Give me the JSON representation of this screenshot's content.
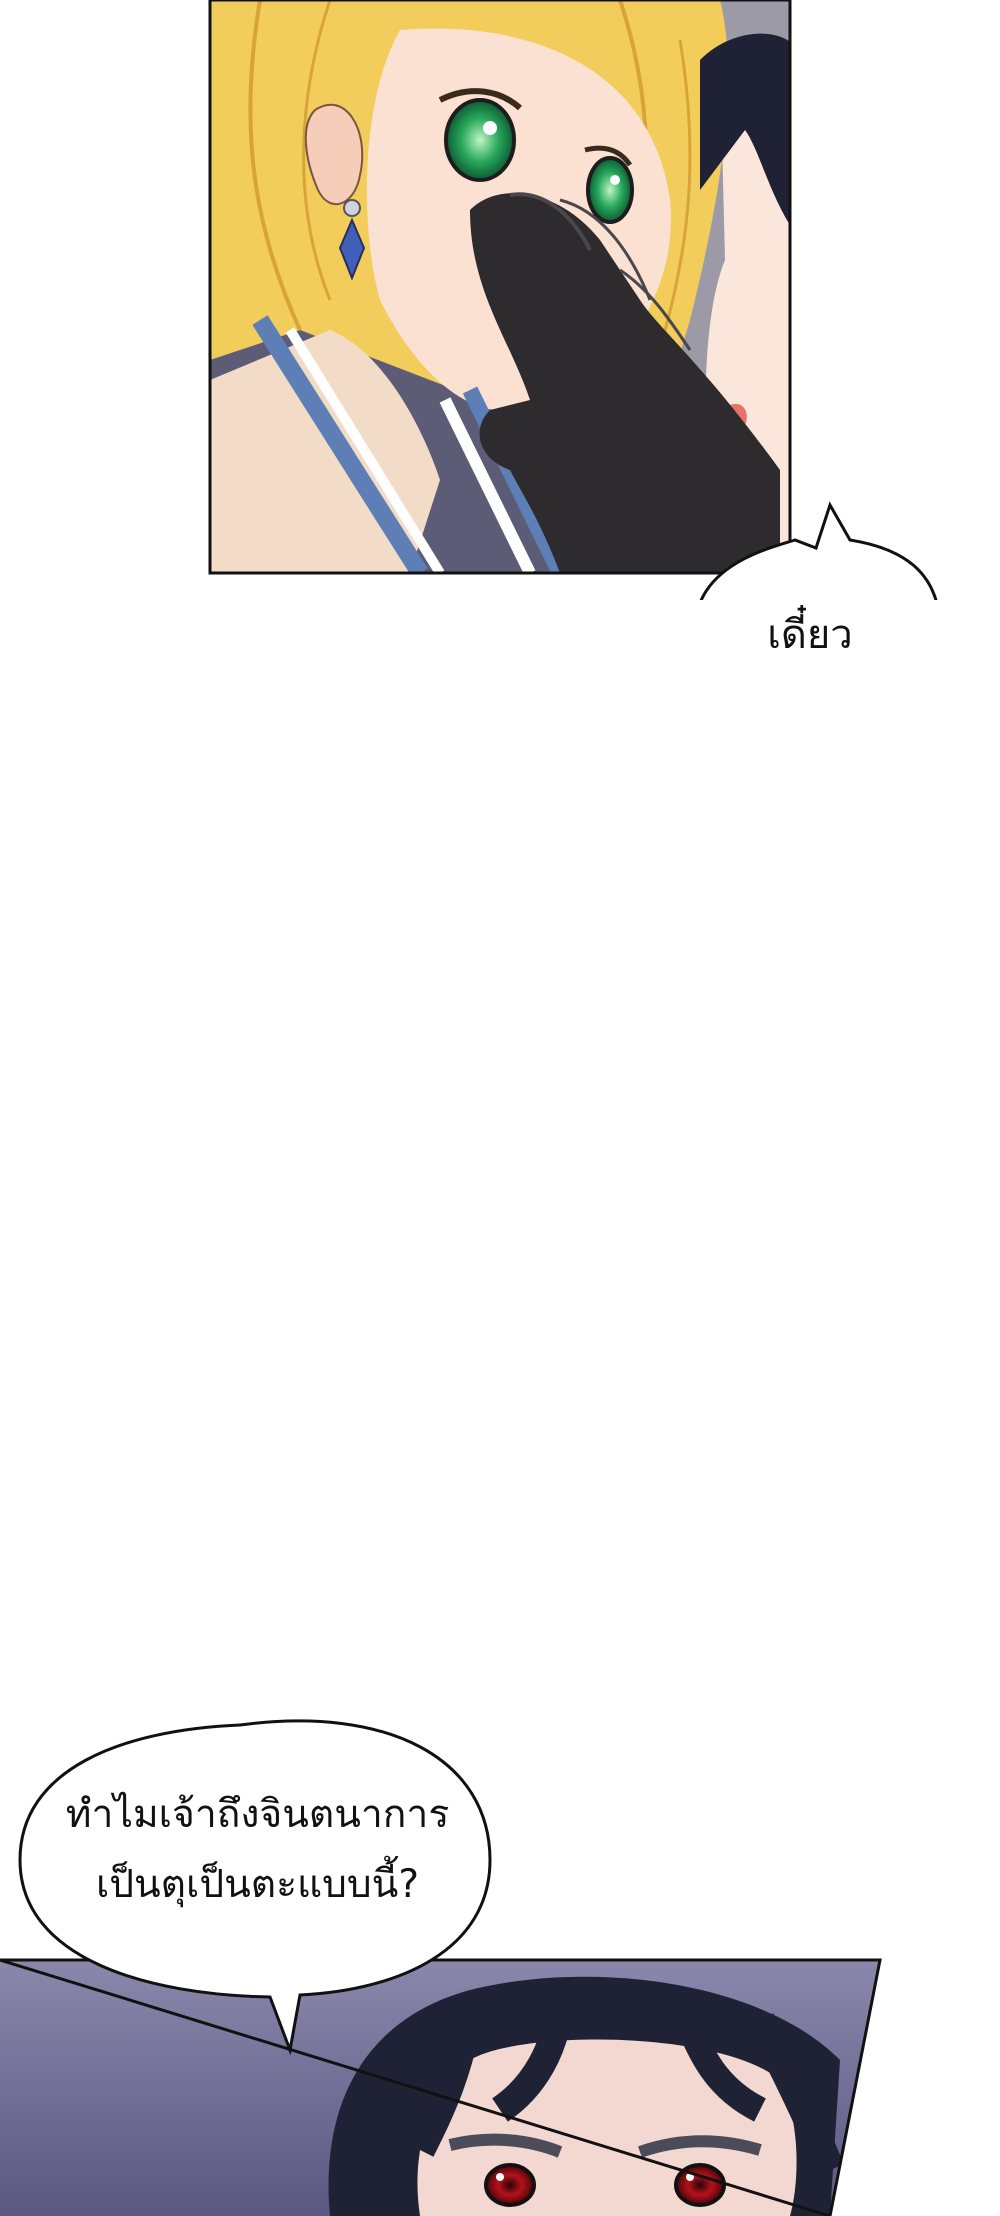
{
  "panels": {
    "top": {
      "description_name": "blonde woman with glove over face"
    },
    "bottom": {
      "description_name": "dark-haired man with red eyes"
    }
  },
  "bubbles": {
    "first": {
      "text": "เดี๋ยว"
    },
    "second": {
      "line1": "ทำไมเจ้าถึงจินตนาการ",
      "line2": "เป็นตุเป็นตะแบบนี้?"
    }
  },
  "colors": {
    "panel_border": "#111111",
    "hair_blonde": "#f3cd5c",
    "eye_green": "#27a85a",
    "glove": "#2d2b2e",
    "bg_purple": "#6c6891",
    "hair_dark": "#1f2234",
    "eye_red": "#b5121b"
  }
}
